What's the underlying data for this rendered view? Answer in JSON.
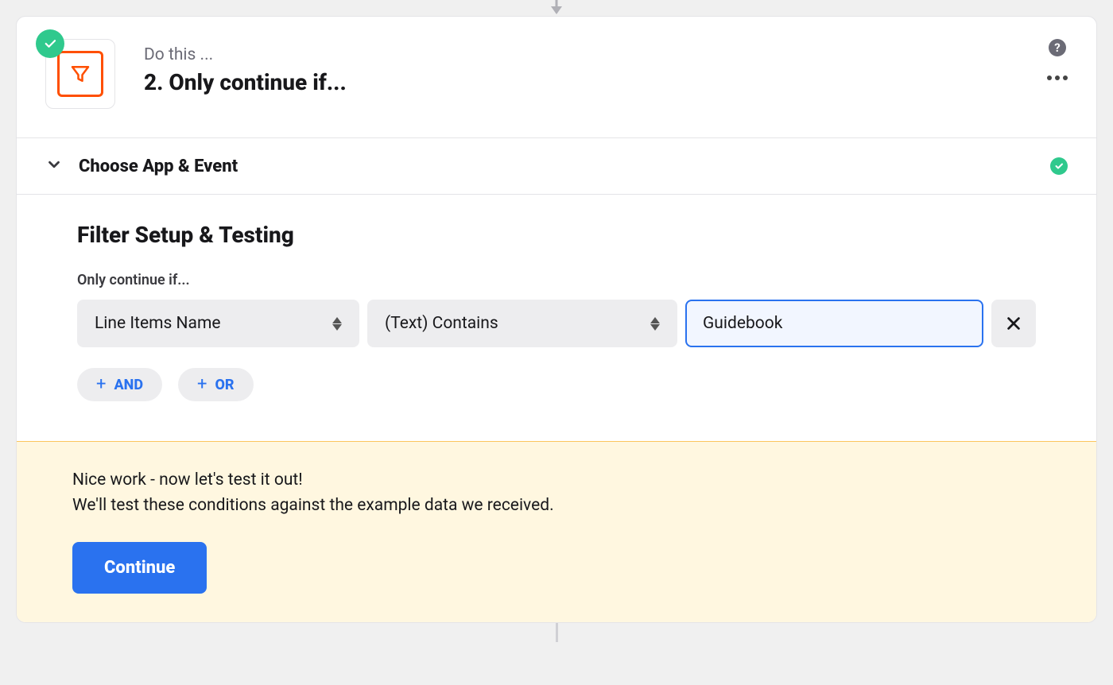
{
  "header": {
    "pretitle": "Do this ...",
    "title": "2. Only continue if..."
  },
  "section": {
    "choose_label": "Choose App & Event"
  },
  "filter": {
    "title": "Filter Setup & Testing",
    "subtitle": "Only continue if...",
    "condition": {
      "field": "Line Items Name",
      "operator": "(Text) Contains",
      "value": "Guidebook"
    },
    "and_label": "AND",
    "or_label": "OR"
  },
  "test": {
    "line1": "Nice work - now let's test it out!",
    "line2": "We'll test these conditions against the example data we received.",
    "button": "Continue"
  }
}
